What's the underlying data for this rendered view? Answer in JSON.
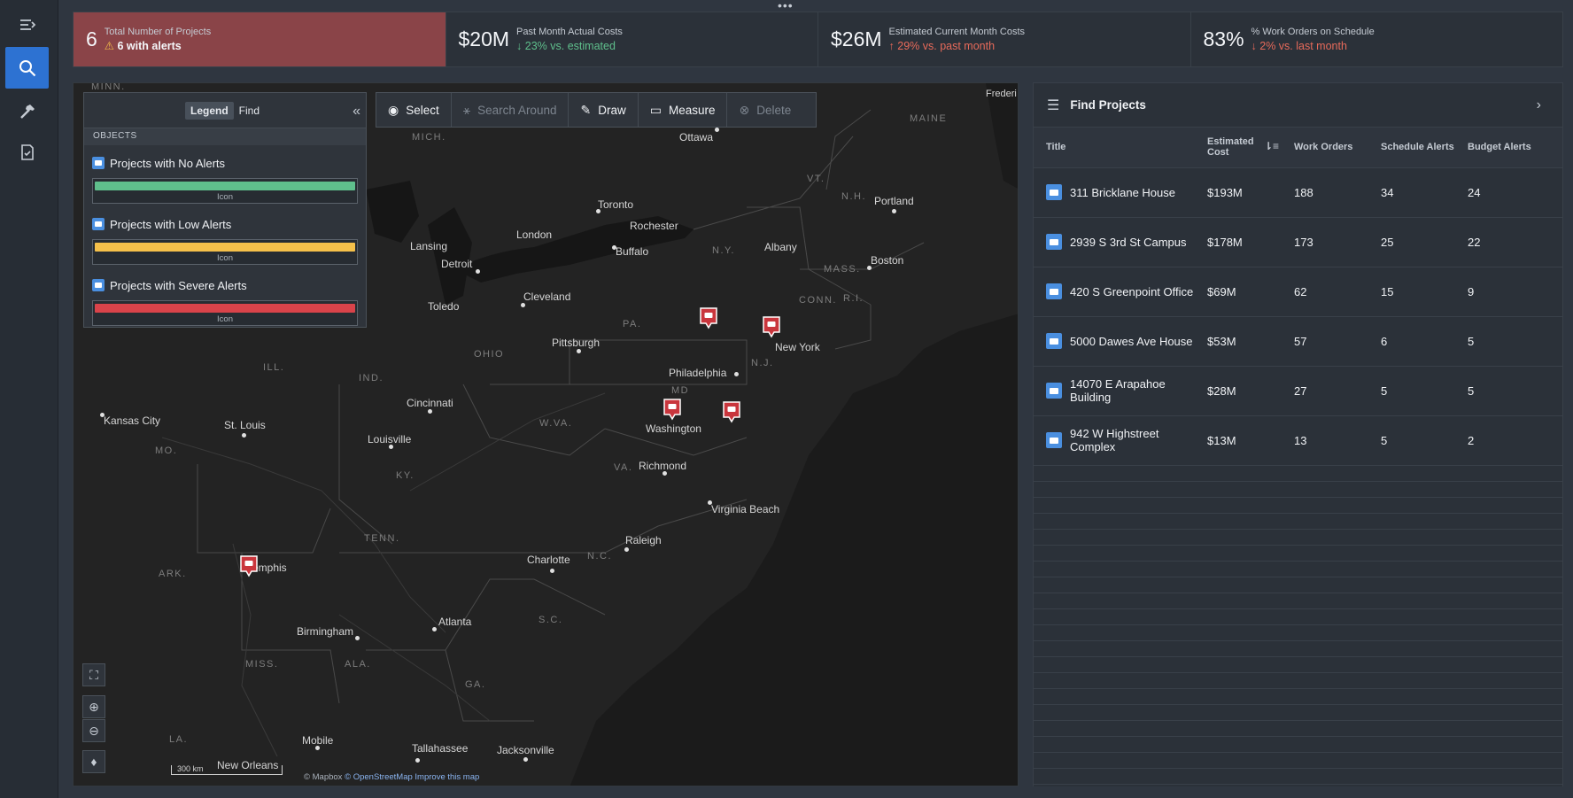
{
  "nav": {
    "items": [
      {
        "name": "collapse-menu-icon"
      },
      {
        "name": "search-icon",
        "active": true
      },
      {
        "name": "hammer-icon"
      },
      {
        "name": "checklist-icon"
      }
    ]
  },
  "metrics": [
    {
      "value": "6",
      "label": "Total Number of Projects",
      "sub": "6 with alerts",
      "type": "alert"
    },
    {
      "value": "$20M",
      "label": "Past Month Actual Costs",
      "sub": "↓ 23% vs. estimated",
      "type": "green"
    },
    {
      "value": "$26M",
      "label": "Estimated Current Month Costs",
      "sub": "↑ 29% vs. past month",
      "type": "red"
    },
    {
      "value": "83%",
      "label": "% Work Orders on Schedule",
      "sub": "↓ 2% vs. last month",
      "type": "red"
    }
  ],
  "legend": {
    "tabs": [
      "Legend",
      "Find"
    ],
    "active_tab": "Legend",
    "section": "OBJECTS",
    "items": [
      {
        "label": "Projects with No Alerts",
        "swatch_caption": "Icon",
        "color": "#5fbf8c"
      },
      {
        "label": "Projects with Low Alerts",
        "swatch_caption": "Icon",
        "color": "#f5c04a"
      },
      {
        "label": "Projects with Severe Alerts",
        "swatch_caption": "Icon",
        "color": "#d9434a"
      }
    ]
  },
  "toolbar": {
    "select": "Select",
    "search_around": "Search Around",
    "draw": "Draw",
    "measure": "Measure",
    "delete": "Delete"
  },
  "map": {
    "states": [
      "MINN.",
      "MICH.",
      "MAINE",
      "VT.",
      "N.H.",
      "MASS.",
      "CONN.",
      "R.I.",
      "N.Y.",
      "PA.",
      "OHIO",
      "IND.",
      "ILL.",
      "MO.",
      "KY.",
      "W.VA.",
      "VA.",
      "MD",
      "N.J.",
      "TENN.",
      "N.C.",
      "ARK.",
      "S.C.",
      "MISS.",
      "ALA.",
      "GA.",
      "LA."
    ],
    "cities": [
      "Ottawa",
      "Toronto",
      "Rochester",
      "Buffalo",
      "Albany",
      "Portland",
      "Boston",
      "Lansing",
      "Detroit",
      "London",
      "Cleveland",
      "Toledo",
      "Pittsburgh",
      "New York",
      "Philadelphia",
      "Washington",
      "Richmond",
      "Virginia Beach",
      "Cincinnati",
      "Louisville",
      "Kansas City",
      "St. Louis",
      "Memphis",
      "Charlotte",
      "Raleigh",
      "Atlanta",
      "Birmingham",
      "Mobile",
      "Tallahassee",
      "Jacksonville",
      "New Orleans",
      "Frederi"
    ],
    "scale": "300 km",
    "attribution_prefix": "© Mapbox",
    "attribution_links": "© OpenStreetMap Improve this map",
    "alert_color": "#c9363d"
  },
  "panel": {
    "title": "Find Projects",
    "columns": [
      "Title",
      "Estimated Cost",
      "Work Orders",
      "Schedule Alerts",
      "Budget Alerts"
    ],
    "rows": [
      {
        "title": "311 Bricklane House",
        "cost": "$193M",
        "orders": "188",
        "schedule": "34",
        "budget": "24"
      },
      {
        "title": "2939 S 3rd St Campus",
        "cost": "$178M",
        "orders": "173",
        "schedule": "25",
        "budget": "22"
      },
      {
        "title": "420 S Greenpoint Office",
        "cost": "$69M",
        "orders": "62",
        "schedule": "15",
        "budget": "9"
      },
      {
        "title": "5000 Dawes Ave House",
        "cost": "$53M",
        "orders": "57",
        "schedule": "6",
        "budget": "5"
      },
      {
        "title": "14070 E Arapahoe Building",
        "cost": "$28M",
        "orders": "27",
        "schedule": "5",
        "budget": "5"
      },
      {
        "title": "942 W Highstreet Complex",
        "cost": "$13M",
        "orders": "13",
        "schedule": "5",
        "budget": "2"
      }
    ]
  },
  "colors": {
    "accent": "#2d72d2",
    "alert_bg": "#8a4448",
    "green": "#5fbf8c",
    "red": "#e76a5a"
  }
}
